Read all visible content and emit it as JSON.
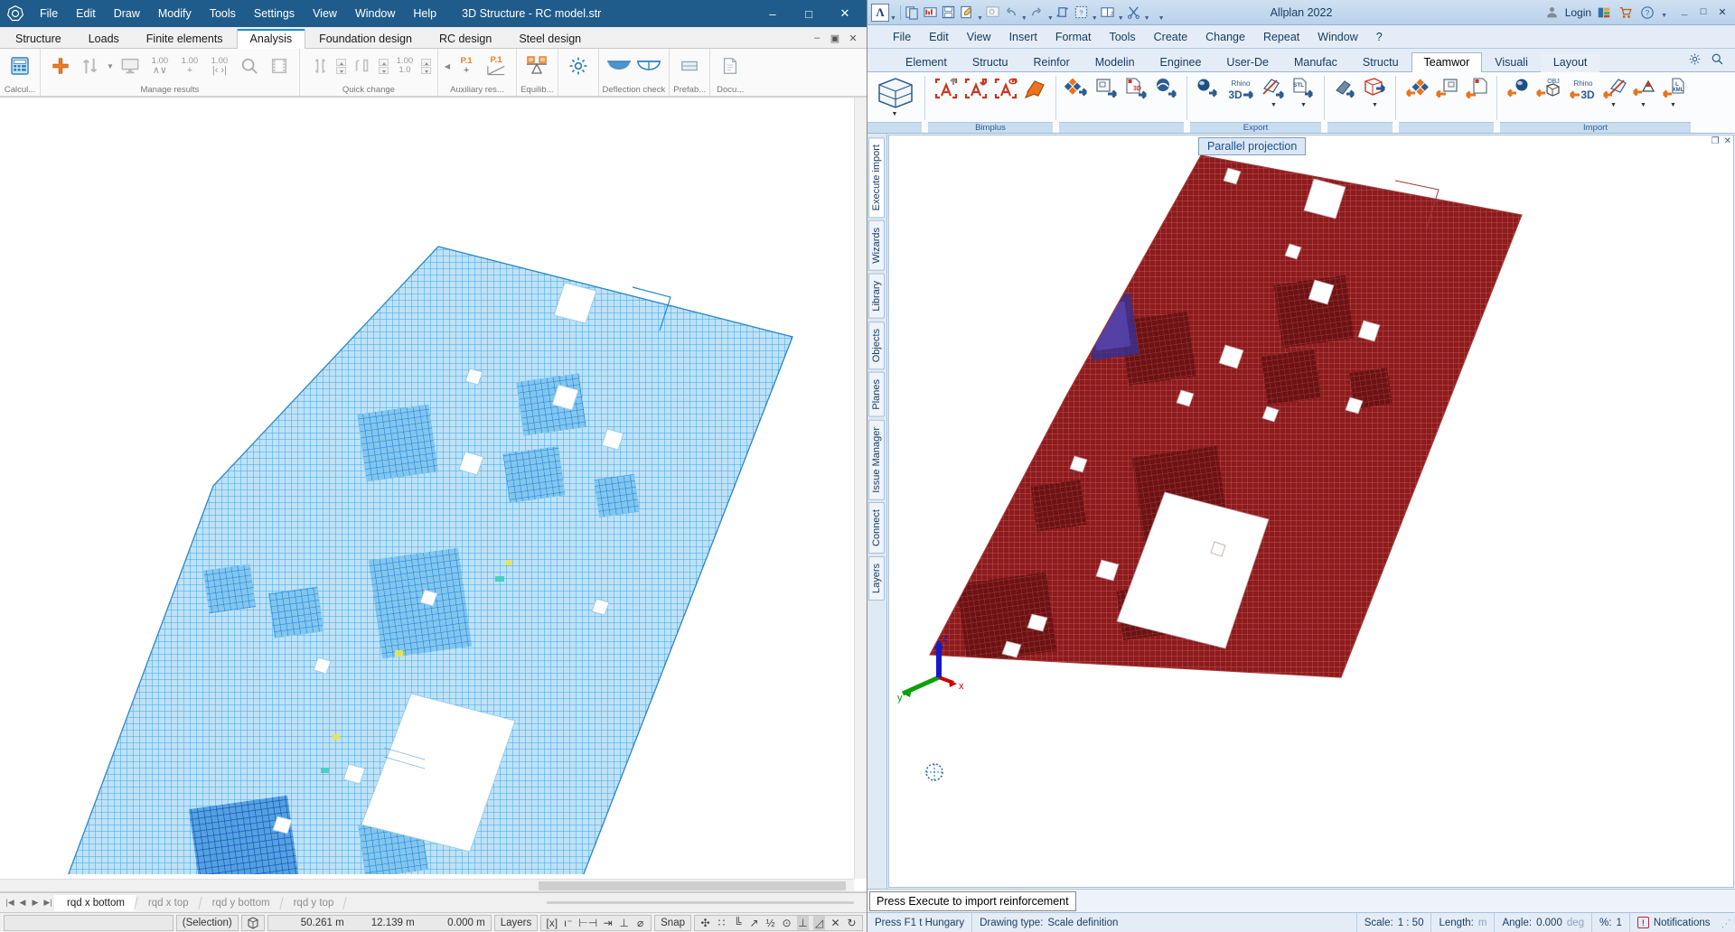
{
  "left_app": {
    "title": "3D Structure - RC model.str",
    "menu": [
      "File",
      "Edit",
      "Draw",
      "Modify",
      "Tools",
      "Settings",
      "View",
      "Window",
      "Help"
    ],
    "window_controls": [
      "–",
      "□",
      "✕"
    ],
    "tabs": [
      {
        "label": "Structure",
        "active": false
      },
      {
        "label": "Loads",
        "active": false
      },
      {
        "label": "Finite elements",
        "active": false
      },
      {
        "label": "Analysis",
        "active": true
      },
      {
        "label": "Foundation design",
        "active": false
      },
      {
        "label": "RC design",
        "active": false
      },
      {
        "label": "Steel design",
        "active": false
      }
    ],
    "tab_window_controls": [
      "–",
      "▣",
      "✕"
    ],
    "ribbon_groups": [
      {
        "label": "Calcul...",
        "items": [
          {
            "name": "calculate-icon",
            "num": "",
            "sub": ""
          }
        ]
      },
      {
        "label": "Manage results",
        "items": [
          {
            "name": "add-result-icon",
            "num": "",
            "sub": ""
          },
          {
            "name": "sort-results-icon",
            "num": "",
            "sub": ""
          },
          {
            "name": "display-monitor-icon",
            "num": "",
            "sub": ""
          },
          {
            "name": "scale-minmax-icon",
            "num": "1.00",
            "sub": "∧∨"
          },
          {
            "name": "scale-plus-icon",
            "num": "1.00",
            "sub": "+"
          },
          {
            "name": "scale-range-icon",
            "num": "1.00",
            "sub": "|‹ ›|"
          },
          {
            "name": "zoom-results-icon",
            "num": "",
            "sub": ""
          },
          {
            "name": "animation-icon",
            "num": "",
            "sub": ""
          }
        ]
      },
      {
        "label": "Quick change",
        "items": [
          {
            "name": "vertical-scale-icon",
            "num": "",
            "sub": ""
          },
          {
            "name": "vertical-scale-spinner",
            "num": "",
            "sub": ""
          },
          {
            "name": "diagram-height-icon",
            "num": "",
            "sub": ""
          },
          {
            "name": "diagram-height-spinner",
            "num": "",
            "sub": ""
          },
          {
            "name": "value-ratio-icon",
            "num": "1.00",
            "sub": "1.0"
          },
          {
            "name": "value-ratio-spinner",
            "num": "",
            "sub": ""
          }
        ]
      },
      {
        "label": "Auxiliary res...",
        "items": [
          {
            "name": "point-result-add-icon",
            "num": "P.1",
            "sub": "+"
          },
          {
            "name": "point-result-section-icon",
            "num": "P.1",
            "sub": ""
          }
        ]
      },
      {
        "label": "Equilib...",
        "items": [
          {
            "name": "equilibrium-check-icon",
            "num": "",
            "sub": ""
          }
        ]
      },
      {
        "label": "",
        "items": [
          {
            "name": "settings-gear-icon",
            "num": "",
            "sub": ""
          }
        ]
      },
      {
        "label": "Deflection check",
        "items": [
          {
            "name": "deflection-check-1-icon",
            "num": "",
            "sub": ""
          },
          {
            "name": "deflection-check-2-icon",
            "num": "",
            "sub": ""
          }
        ]
      },
      {
        "label": "Prefab...",
        "items": [
          {
            "name": "prefab-icon",
            "num": "",
            "sub": ""
          }
        ]
      },
      {
        "label": "Docu...",
        "items": [
          {
            "name": "documentation-icon",
            "num": "",
            "sub": ""
          }
        ]
      }
    ],
    "sheet_tabs": [
      {
        "label": "rqd x bottom",
        "active": true
      },
      {
        "label": "rqd x top",
        "active": false
      },
      {
        "label": "rqd y bottom",
        "active": false
      },
      {
        "label": "rqd y top",
        "active": false
      }
    ],
    "status": {
      "selection": "(Selection)",
      "coord_x": "50.261 m",
      "coord_y": "12.139 m",
      "coord_z": "0.000 m",
      "layers": "Layers",
      "snap": "Snap",
      "snap_icons": [
        "[x]",
        "ı⁻",
        "⊢⊣",
        "⇥",
        "⊥",
        "⌀"
      ],
      "osnap_icons": [
        "✣",
        "∷",
        "╚",
        "↗",
        "½",
        "⊙",
        "⊥",
        "◿",
        "✕",
        "↻"
      ]
    }
  },
  "right_app": {
    "title": "Allplan 2022",
    "quick_icons": [
      "allplan-logo-icon",
      "open-project-icon",
      "layout-icon",
      "save-icon",
      "edit-icon",
      "preview-icon",
      "undo-icon",
      "redo-icon",
      "refresh-icon",
      "wizard-icon",
      "split-window-icon",
      "cut-icon",
      "more-icon"
    ],
    "login_label": "Login",
    "right_icons": [
      "user-icon",
      "connect-icon",
      "shop-cart-icon",
      "help-icon"
    ],
    "window_controls": [
      "_",
      "□",
      "✕"
    ],
    "menu": [
      "File",
      "Edit",
      "View",
      "Insert",
      "Format",
      "Tools",
      "Create",
      "Change",
      "Repeat",
      "Window",
      "?"
    ],
    "tabs": [
      {
        "label": "Element",
        "active": false
      },
      {
        "label": "Structu",
        "active": false
      },
      {
        "label": "Reinfor",
        "active": false
      },
      {
        "label": "Modelin",
        "active": false
      },
      {
        "label": "Enginee",
        "active": false
      },
      {
        "label": "User-De",
        "active": false
      },
      {
        "label": "Manufac",
        "active": false
      },
      {
        "label": "Structu",
        "active": false
      },
      {
        "label": "Teamwor",
        "active": true
      },
      {
        "label": "Visuali",
        "active": false
      },
      {
        "label": "Layout",
        "active": false,
        "hover": true
      }
    ],
    "tab_tools": [
      "gear-icon",
      "search-icon"
    ],
    "ribbon_groups": [
      {
        "label": "",
        "items": [
          {
            "name": "bimplus-model-icon",
            "dd": true
          }
        ]
      },
      {
        "label": "Bimplus",
        "items": [
          {
            "name": "bimplus-upload-icon",
            "dd": false
          },
          {
            "name": "bimplus-download-icon",
            "dd": false
          },
          {
            "name": "bimplus-view-icon",
            "dd": false
          },
          {
            "name": "bimplus-attributes-icon",
            "dd": false
          }
        ]
      },
      {
        "label": "",
        "items": [
          {
            "name": "export-ifc-icon",
            "dd": false
          },
          {
            "name": "export-dwg-icon",
            "dd": false
          },
          {
            "name": "export-3d-pdf-icon",
            "dd": false
          },
          {
            "name": "export-sketchup-icon",
            "dd": false
          }
        ]
      },
      {
        "label": "Export",
        "items": [
          {
            "name": "export-cinema4d-icon",
            "dd": false
          },
          {
            "name": "export-rhino-3d-icon",
            "dd": false
          },
          {
            "name": "export-attributes-icon",
            "dd": true
          },
          {
            "name": "export-stl-icon",
            "dd": true
          }
        ]
      },
      {
        "label": "",
        "items": [
          {
            "name": "export-pointcloud-icon",
            "dd": false
          },
          {
            "name": "export-volume-icon",
            "dd": true
          }
        ]
      },
      {
        "label": "",
        "items": [
          {
            "name": "import-ifc-icon",
            "dd": false
          },
          {
            "name": "import-dwg-icon",
            "dd": false
          },
          {
            "name": "import-pdf-icon",
            "dd": false
          }
        ]
      },
      {
        "label": "Import",
        "items": [
          {
            "name": "import-cinema4d-icon",
            "dd": false
          },
          {
            "name": "import-obj-icon",
            "dd": false
          },
          {
            "name": "import-rhino-3d-icon",
            "dd": false
          },
          {
            "name": "import-attributes-icon",
            "dd": true
          },
          {
            "name": "import-stl-icon",
            "dd": true
          },
          {
            "name": "import-xml-icon",
            "dd": true
          }
        ]
      }
    ],
    "side_tabs": [
      {
        "label": "Execute import",
        "active": true
      },
      {
        "label": "Wizards",
        "active": false
      },
      {
        "label": "Library",
        "active": false
      },
      {
        "label": "Objects",
        "active": false
      },
      {
        "label": "Planes",
        "active": false
      },
      {
        "label": "Issue Manager",
        "active": false
      },
      {
        "label": "Connect",
        "active": false
      },
      {
        "label": "Layers",
        "active": false
      }
    ],
    "tooltip": "Parallel projection",
    "viewport_controls": [
      "❐",
      "✕"
    ],
    "axis_labels": {
      "x": "x",
      "y": "y",
      "z": "z"
    },
    "command_prompt": "Press Execute to import reinforcement",
    "status": {
      "help": "Press F1 t Hungary",
      "drawing_type_label": "Drawing type:",
      "drawing_type_value": "Scale definition",
      "scale_label": "Scale:",
      "scale_value": "1 : 50",
      "length_label": "Length:",
      "length_value": "m",
      "angle_label": "Angle:",
      "angle_value": "0.000",
      "angle_unit": "deg",
      "percent_label": "%:",
      "percent_value": "1",
      "notifications": "Notifications"
    }
  },
  "colors": {
    "left_titlebar": "#1f5c8b",
    "left_accent": "#1a8cd8",
    "mesh_blue": "#3aa7e8",
    "mesh_blue_dark": "#1250c8",
    "right_titlebar": "#b9d2ea",
    "mesh_red": "#9b1f22",
    "mesh_red_dark": "#5c1012",
    "accent_orange": "#e8741e",
    "tooltip_bg": "#dbe7f4"
  }
}
